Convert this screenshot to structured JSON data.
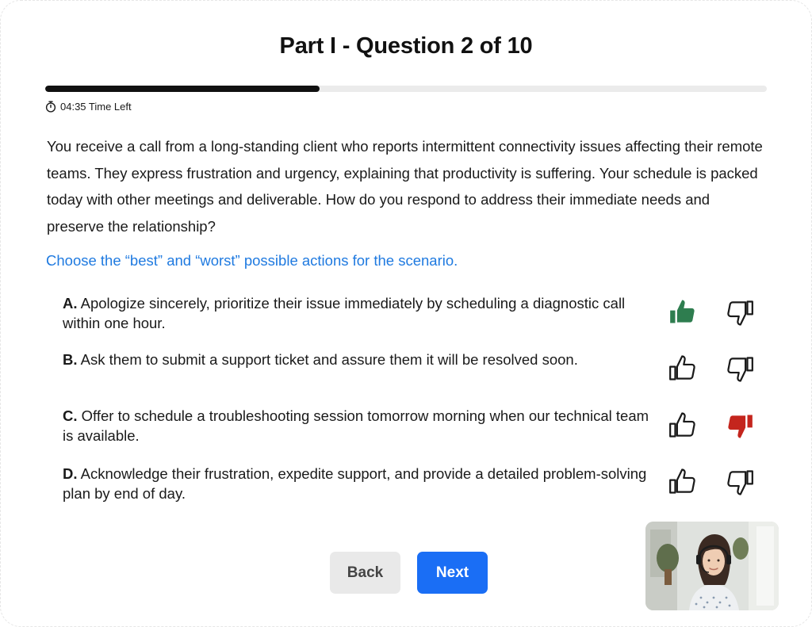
{
  "header": {
    "title": "Part I - Question 2 of 10"
  },
  "progress": {
    "fraction": 0.38
  },
  "timer": {
    "text": "04:35 Time Left",
    "icon": "stopwatch-icon"
  },
  "question": {
    "text": "You receive a call from a long-standing client who reports intermittent connectivity issues affecting their remote teams. They express frustration and urgency, explaining that productivity is suffering. Your schedule is packed today with other meetings and deliverable. How do you respond to address their immediate needs and preserve the relationship?"
  },
  "instruction": {
    "text": "Choose the “best” and “worst” possible actions for the scenario."
  },
  "options": [
    {
      "letter": "A.",
      "text": " Apologize sincerely, prioritize their issue immediately by scheduling a diagnostic call within one hour.",
      "selection": "best"
    },
    {
      "letter": "B.",
      "text": " Ask them to submit a support ticket and assure them it will be resolved soon.",
      "selection": "none"
    },
    {
      "letter": "C.",
      "text": " Offer to schedule a troubleshooting session tomorrow morning when our technical team is available.",
      "selection": "worst"
    },
    {
      "letter": "D.",
      "text": " Acknowledge their frustration, expedite support, and provide a detailed problem-solving plan by end of day.",
      "selection": "none"
    }
  ],
  "icons": {
    "best": "thumbs-up-icon",
    "worst": "thumbs-down-icon"
  },
  "colors": {
    "best_selected": "#2e7d4f",
    "worst_selected": "#c4251d",
    "instruction": "#1f7ae0",
    "next_button": "#1a6ef5",
    "back_button": "#e9e9e9"
  },
  "navigation": {
    "back_label": "Back",
    "next_label": "Next"
  }
}
